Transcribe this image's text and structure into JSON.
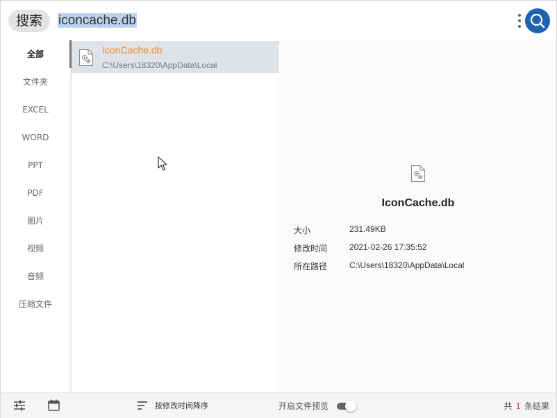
{
  "search": {
    "label": "搜索",
    "query": "iconcache.db"
  },
  "sidebar": {
    "items": [
      {
        "label": "全部",
        "active": true
      },
      {
        "label": "文件夹"
      },
      {
        "label": "EXCEL"
      },
      {
        "label": "WORD"
      },
      {
        "label": "PPT"
      },
      {
        "label": "PDF"
      },
      {
        "label": "图片"
      },
      {
        "label": "视频"
      },
      {
        "label": "音频"
      },
      {
        "label": "压缩文件"
      }
    ]
  },
  "results": [
    {
      "name": "IconCache.db",
      "path": "C:\\Users\\18320\\AppData\\Local",
      "icon": "settings-file-icon"
    }
  ],
  "preview": {
    "title": "IconCache.db",
    "fields": [
      {
        "label": "大小",
        "value": "231.49KB"
      },
      {
        "label": "修改时间",
        "value": "2021-02-26 17:35:52"
      },
      {
        "label": "所在路径",
        "value": "C:\\Users\\18320\\AppData\\Local"
      }
    ]
  },
  "bottombar": {
    "sort_label": "按修改时间降序",
    "preview_toggle_label": "开启文件预览",
    "preview_enabled": true,
    "count_prefix": "共",
    "count_value": "1",
    "count_suffix": "条结果"
  },
  "colors": {
    "accent": "#1e63b0",
    "result_name": "#f08a2c",
    "selected_row": "#dfe2e6",
    "count_number": "#e0483a"
  }
}
